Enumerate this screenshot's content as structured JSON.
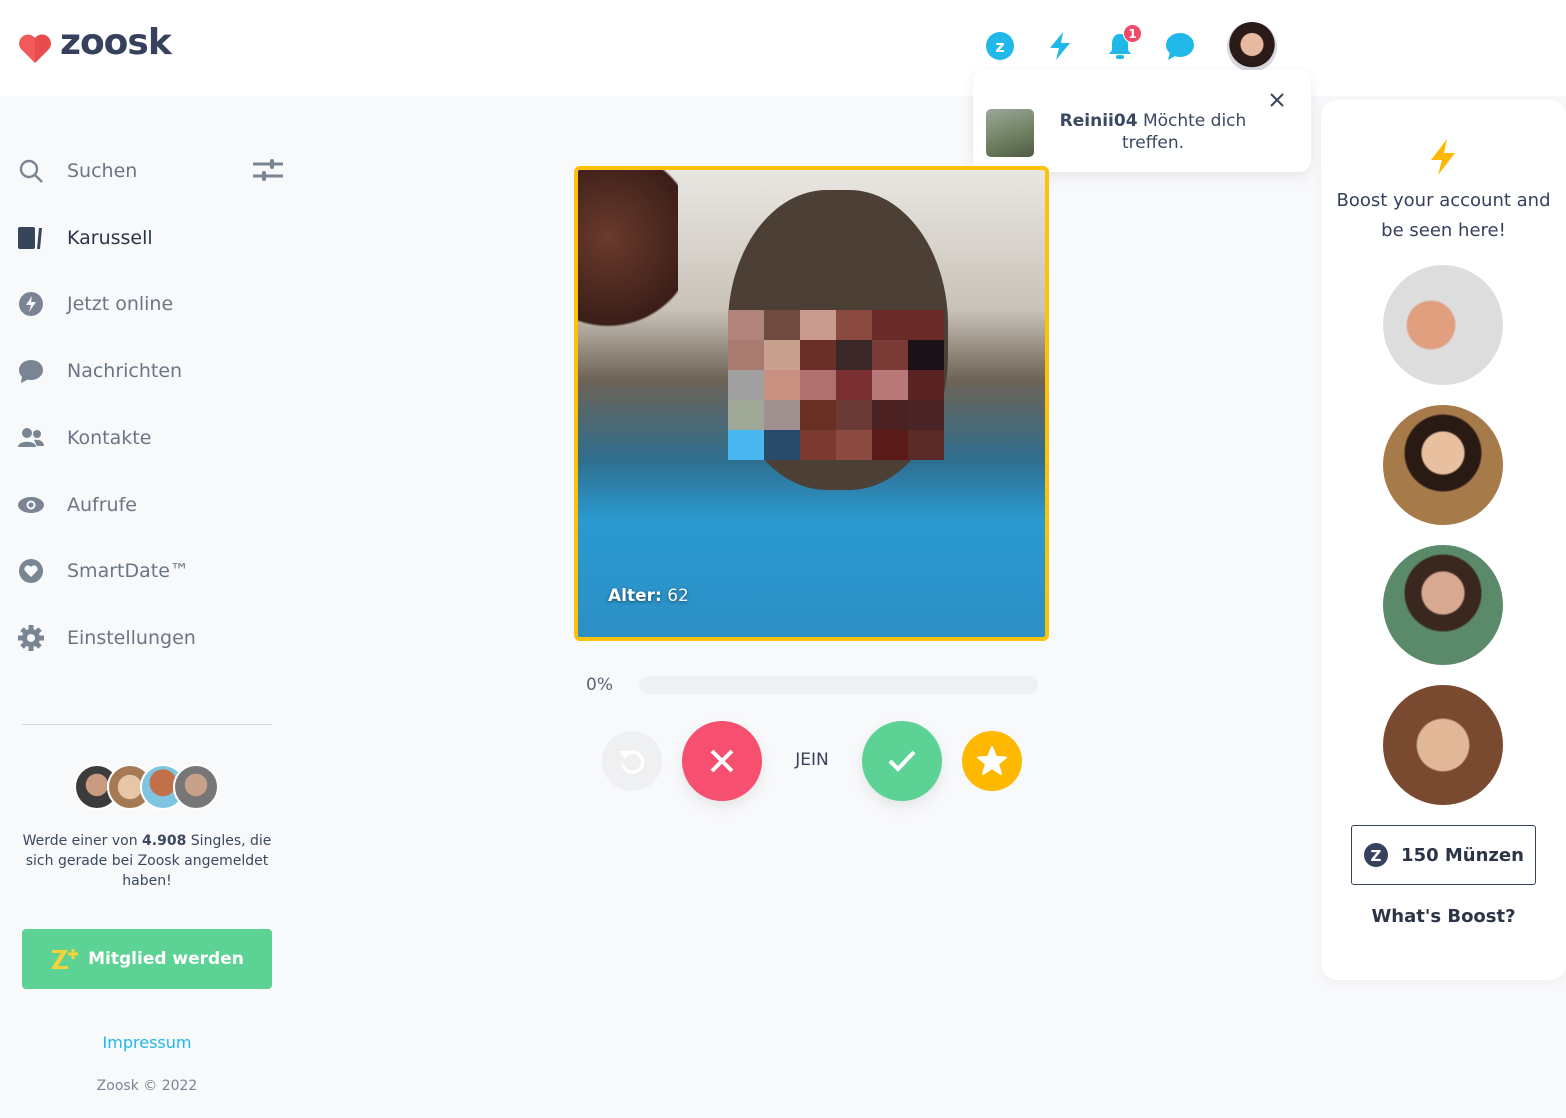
{
  "header": {
    "brand": "zoosk",
    "notification_count": "1",
    "icons": [
      "coins-icon",
      "boost-icon",
      "bell-icon",
      "chat-icon"
    ]
  },
  "notification": {
    "user": "Reinii04",
    "message": " Möchte dich",
    "message2": "treffen."
  },
  "sidebar": {
    "items": [
      {
        "label": "Suchen",
        "icon": "search-icon"
      },
      {
        "label": "Karussell",
        "icon": "carousel-icon",
        "active": true
      },
      {
        "label": "Jetzt online",
        "icon": "online-icon"
      },
      {
        "label": "Nachrichten",
        "icon": "chat-icon"
      },
      {
        "label": "Kontakte",
        "icon": "contacts-icon"
      },
      {
        "label": "Aufrufe",
        "icon": "eye-icon"
      },
      {
        "label": "SmartDate™",
        "icon": "smartdate-icon"
      },
      {
        "label": "Einstellungen",
        "icon": "gear-icon"
      }
    ],
    "promo_pre": "Werde einer von ",
    "promo_count": "4.908",
    "promo_post": " Singles, die sich gerade bei Zoosk angemeldet haben!",
    "join_button": "Mitglied werden",
    "impressum": "Impressum",
    "copyright": "Zoosk © 2022"
  },
  "card": {
    "age_label": "Alter:",
    "age": " 62",
    "progress_label": "0%",
    "progress_percent": 0
  },
  "actions": {
    "maybe": "JEIN"
  },
  "boost": {
    "title": "Boost your account and be seen here!",
    "coins": "150 Münzen",
    "whats_boost": "What's Boost?"
  },
  "colors": {
    "accent": "#1fb8e8",
    "no": "#f64f6f",
    "yes": "#5cd394",
    "star": "#ffb800",
    "card_border": "#ffc107",
    "join": "#5cd394"
  }
}
